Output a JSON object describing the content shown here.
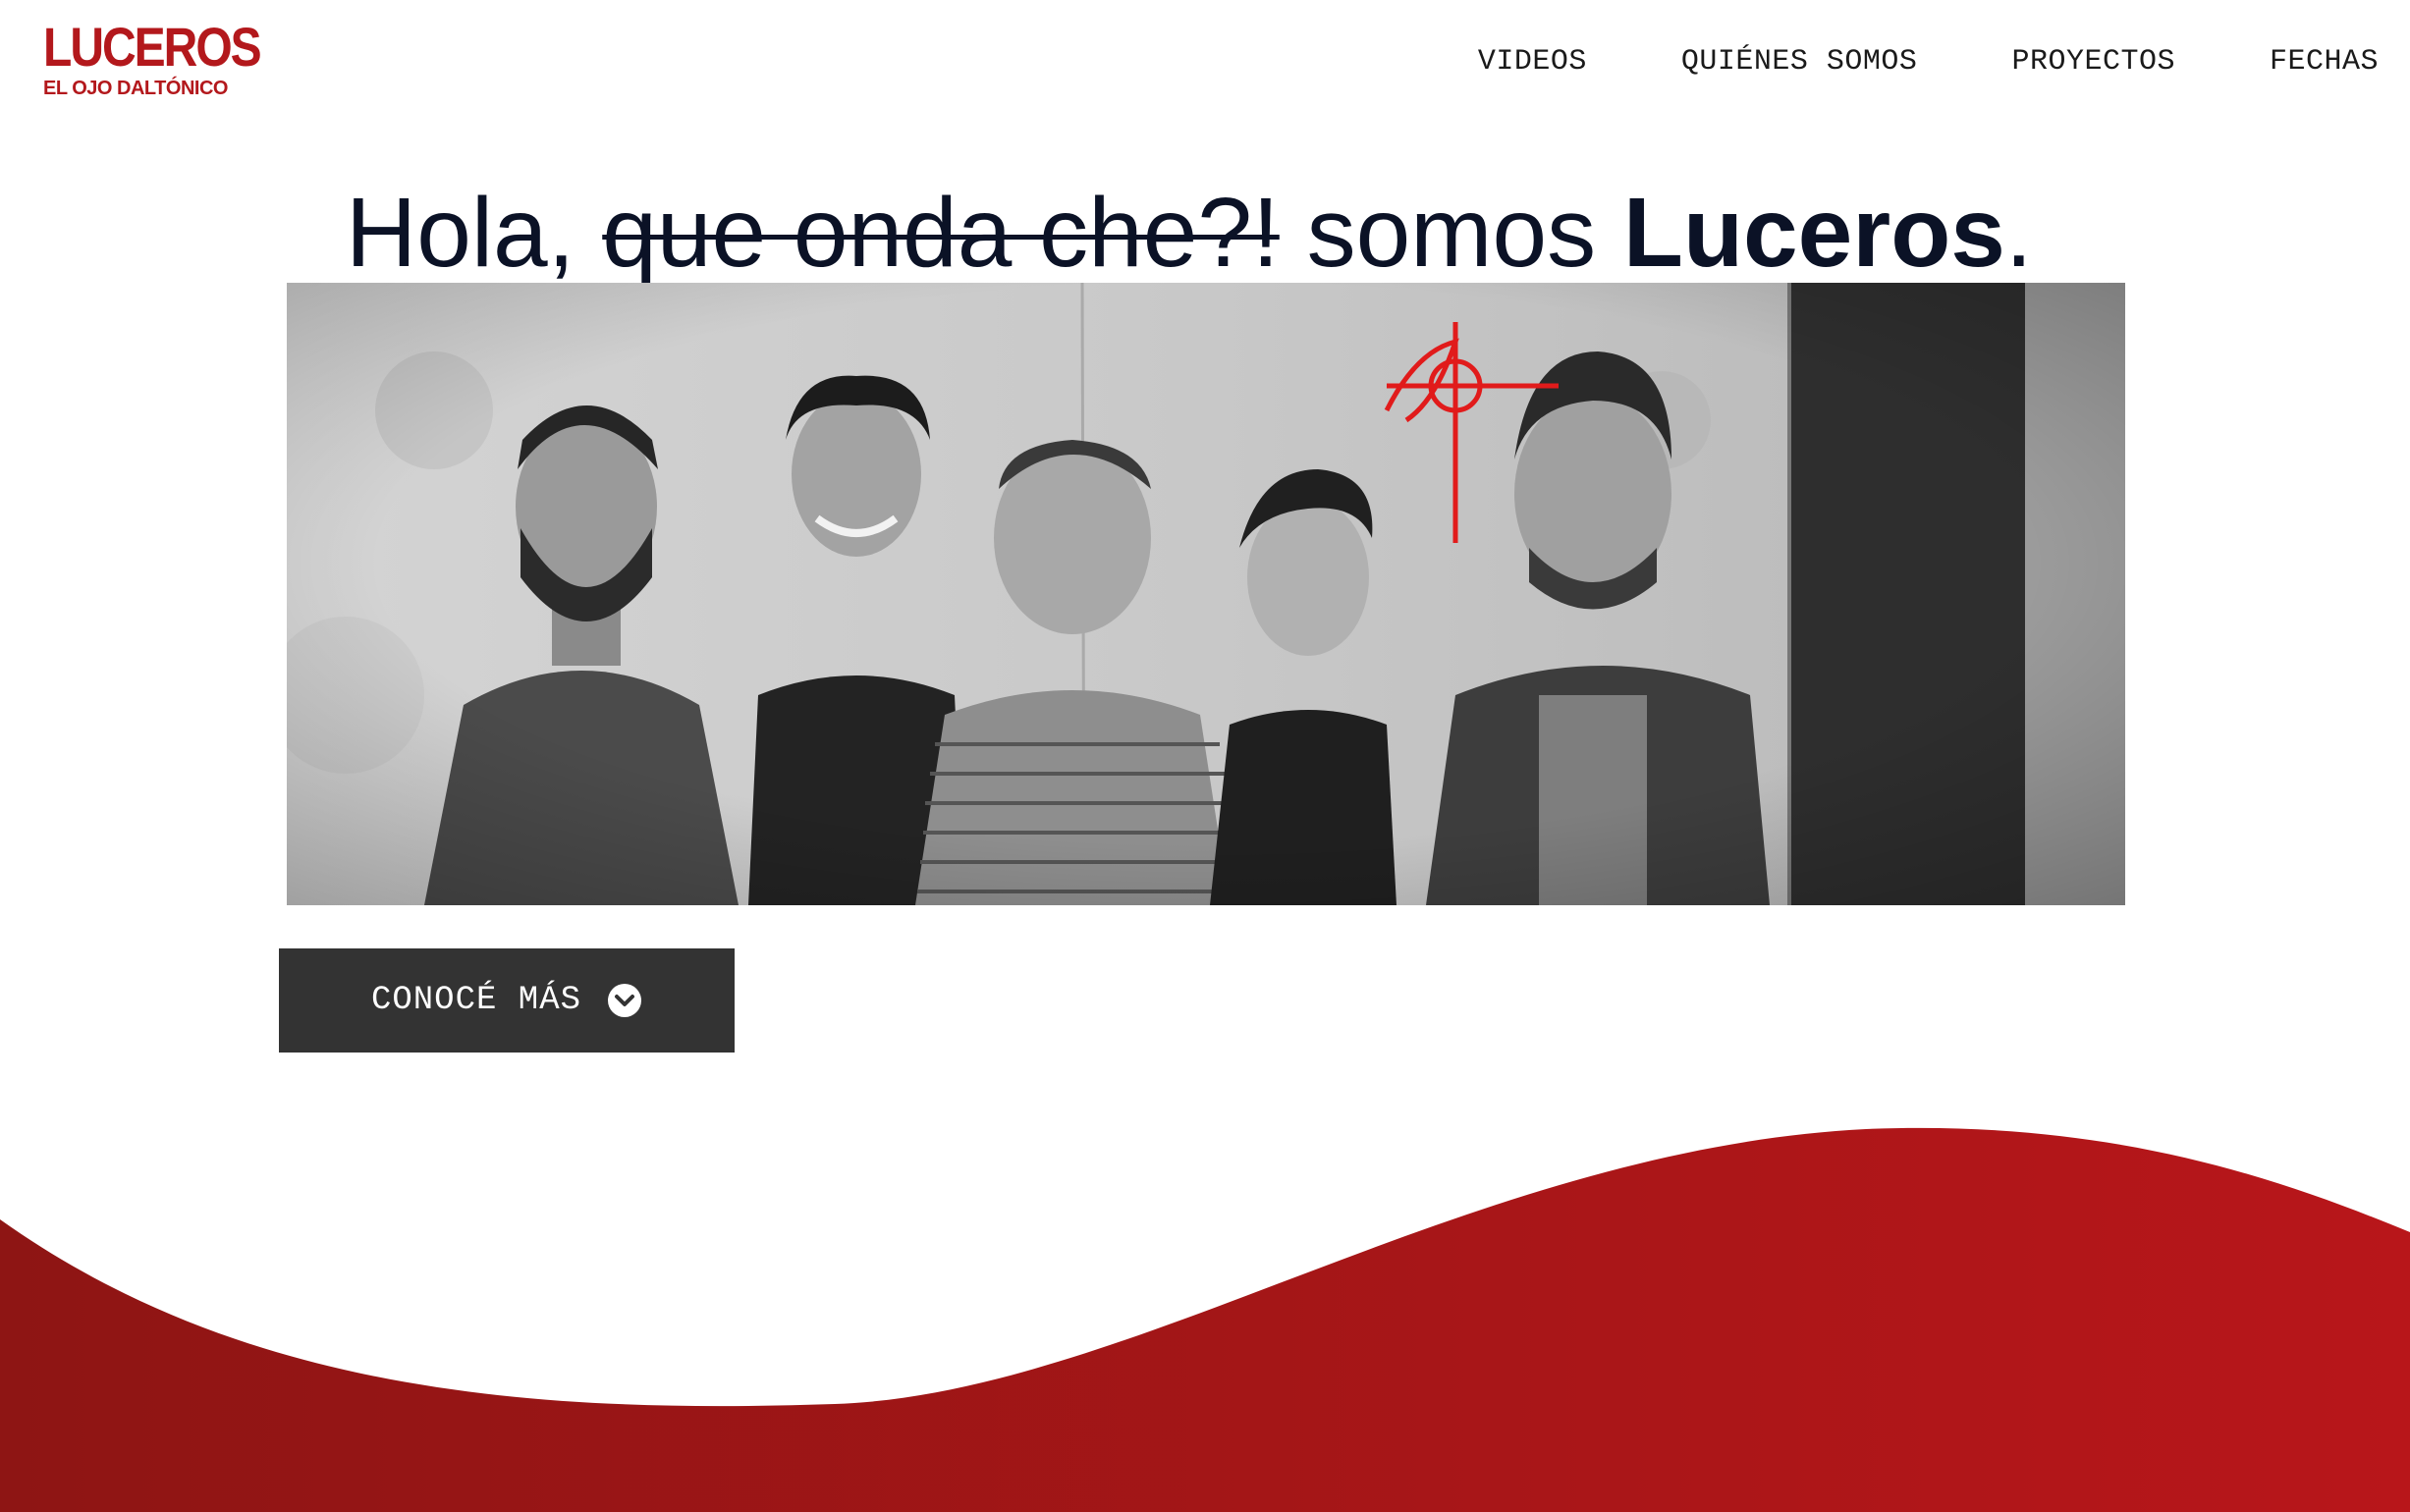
{
  "header": {
    "logo": {
      "main": "LUCEROS",
      "sub": "EL OJO DALTÓNICO"
    },
    "nav": [
      {
        "label": "VIDEOS"
      },
      {
        "label": "QUIÉNES SOMOS"
      },
      {
        "label": "PROYECTOS"
      },
      {
        "label": "FECHAS"
      }
    ]
  },
  "hero": {
    "greeting": "Hola,",
    "struck_text": "que onda che?!",
    "middle": "somos",
    "band_name": "Luceros",
    "end": ".",
    "image_icon": "band-photo"
  },
  "cta": {
    "label": "CONOCÉ MÁS",
    "icon": "chevron-down-circle-icon"
  },
  "colors": {
    "brand_red": "#b3181c",
    "wave_red_light": "#b8161a",
    "wave_red_dark": "#8e1514",
    "button_bg": "#333333",
    "headline_text": "#0b1226"
  }
}
